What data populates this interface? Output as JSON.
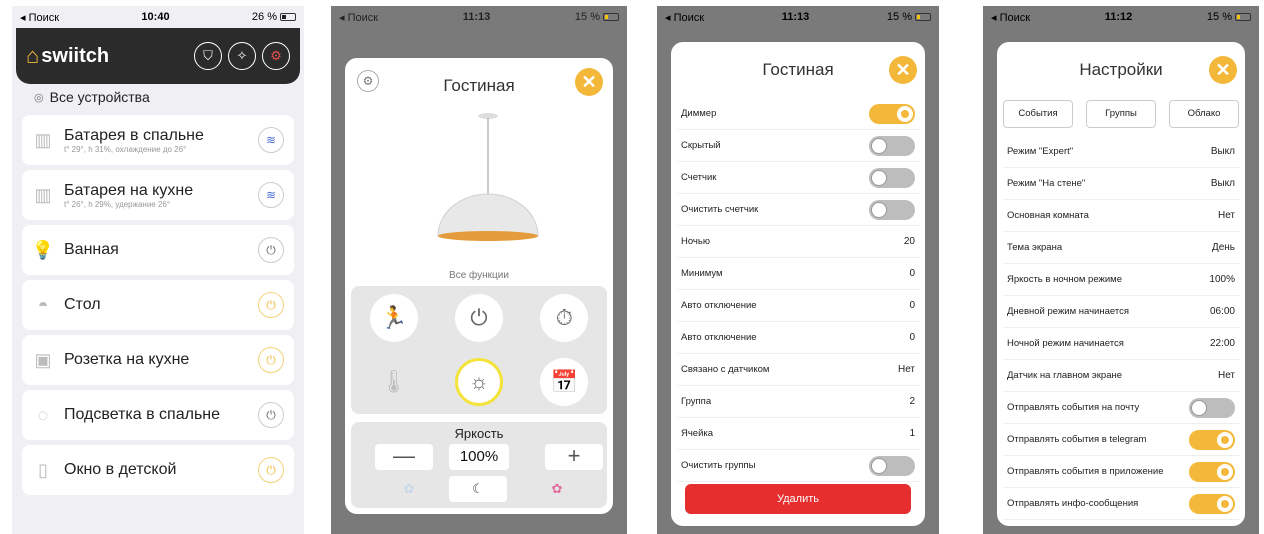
{
  "colors": {
    "accent": "#f3b83a",
    "danger": "#e62e2e",
    "dark": "#2b2b2b"
  },
  "phone1": {
    "status": {
      "carrier": "◂ Поиск",
      "time": "10:40",
      "battery": "26 %"
    },
    "app_name": "swiitch",
    "all_devices": "Все устройства",
    "devices": [
      {
        "name": "Батарея в спальне",
        "sub": "t° 29°, h 31%, охлаждение до 26°",
        "icon": "radiator-icon",
        "btn": "heat-icon"
      },
      {
        "name": "Батарея на кухне",
        "sub": "t° 26°, h 29%, удержание 26°",
        "icon": "radiator-icon",
        "btn": "heat-icon"
      },
      {
        "name": "Ванная",
        "sub": "",
        "icon": "bulb-icon",
        "btn": "power-icon"
      },
      {
        "name": "Стол",
        "sub": "",
        "icon": "lamp-icon",
        "btn": "power-icon"
      },
      {
        "name": "Розетка на кухне",
        "sub": "",
        "icon": "socket-icon",
        "btn": "power-icon"
      },
      {
        "name": "Подсветка в спальне",
        "sub": "",
        "icon": "ledstrip-icon",
        "btn": "power-icon"
      },
      {
        "name": "Окно в детской",
        "sub": "",
        "icon": "window-icon",
        "btn": "power-icon"
      }
    ]
  },
  "phone2": {
    "status": {
      "carrier": "◂ Поиск",
      "time": "11:13",
      "battery": "15 %"
    },
    "title": "Гостиная",
    "all_functions": "Все функции",
    "brightness_label": "Яркость",
    "brightness_value": "100%",
    "minus": "—",
    "plus": "+"
  },
  "phone3": {
    "status": {
      "carrier": "◂ Поиск",
      "time": "11:13",
      "battery": "15 %"
    },
    "title": "Гостиная",
    "rows": [
      {
        "label": "Диммер",
        "type": "toggle",
        "on": true
      },
      {
        "label": "Скрытый",
        "type": "toggle",
        "on": false
      },
      {
        "label": "Счетчик",
        "type": "toggle",
        "on": false
      },
      {
        "label": "Очистить счетчик",
        "type": "toggle",
        "on": false
      },
      {
        "label": "Ночью",
        "type": "value",
        "value": "20"
      },
      {
        "label": "Минимум",
        "type": "value",
        "value": "0"
      },
      {
        "label": "Авто отключение",
        "type": "value",
        "value": "0"
      },
      {
        "label": "Авто отключение",
        "type": "value",
        "value": "0"
      },
      {
        "label": "Связано с датчиком",
        "type": "value",
        "value": "Нет"
      },
      {
        "label": "Группа",
        "type": "value",
        "value": "2"
      },
      {
        "label": "Ячейка",
        "type": "value",
        "value": "1"
      },
      {
        "label": "Очистить группы",
        "type": "toggle",
        "on": false
      }
    ],
    "delete_label": "Удалить"
  },
  "phone4": {
    "status": {
      "carrier": "◂ Поиск",
      "time": "11:12",
      "battery": "15 %"
    },
    "title": "Настройки",
    "tabs": [
      "События",
      "Группы",
      "Облако"
    ],
    "rows": [
      {
        "label": "Режим \"Expert\"",
        "type": "value",
        "value": "Выкл"
      },
      {
        "label": "Режим \"На стене\"",
        "type": "value",
        "value": "Выкл"
      },
      {
        "label": "Основная комната",
        "type": "value",
        "value": "Нет"
      },
      {
        "label": "Тема экрана",
        "type": "value",
        "value": "День"
      },
      {
        "label": "Яркость в ночном режиме",
        "type": "value",
        "value": "100%"
      },
      {
        "label": "Дневной режим начинается",
        "type": "value",
        "value": "06:00"
      },
      {
        "label": "Ночной режим начинается",
        "type": "value",
        "value": "22:00"
      },
      {
        "label": "Датчик на главном экране",
        "type": "value",
        "value": "Нет"
      },
      {
        "label": "Отправлять события на почту",
        "type": "toggle",
        "on": false
      },
      {
        "label": "Отправлять события в telegram",
        "type": "toggle",
        "on": true
      },
      {
        "label": "Отправлять события в приложение",
        "type": "toggle",
        "on": true
      },
      {
        "label": "Отправлять инфо-сообщения",
        "type": "toggle",
        "on": true
      }
    ]
  }
}
